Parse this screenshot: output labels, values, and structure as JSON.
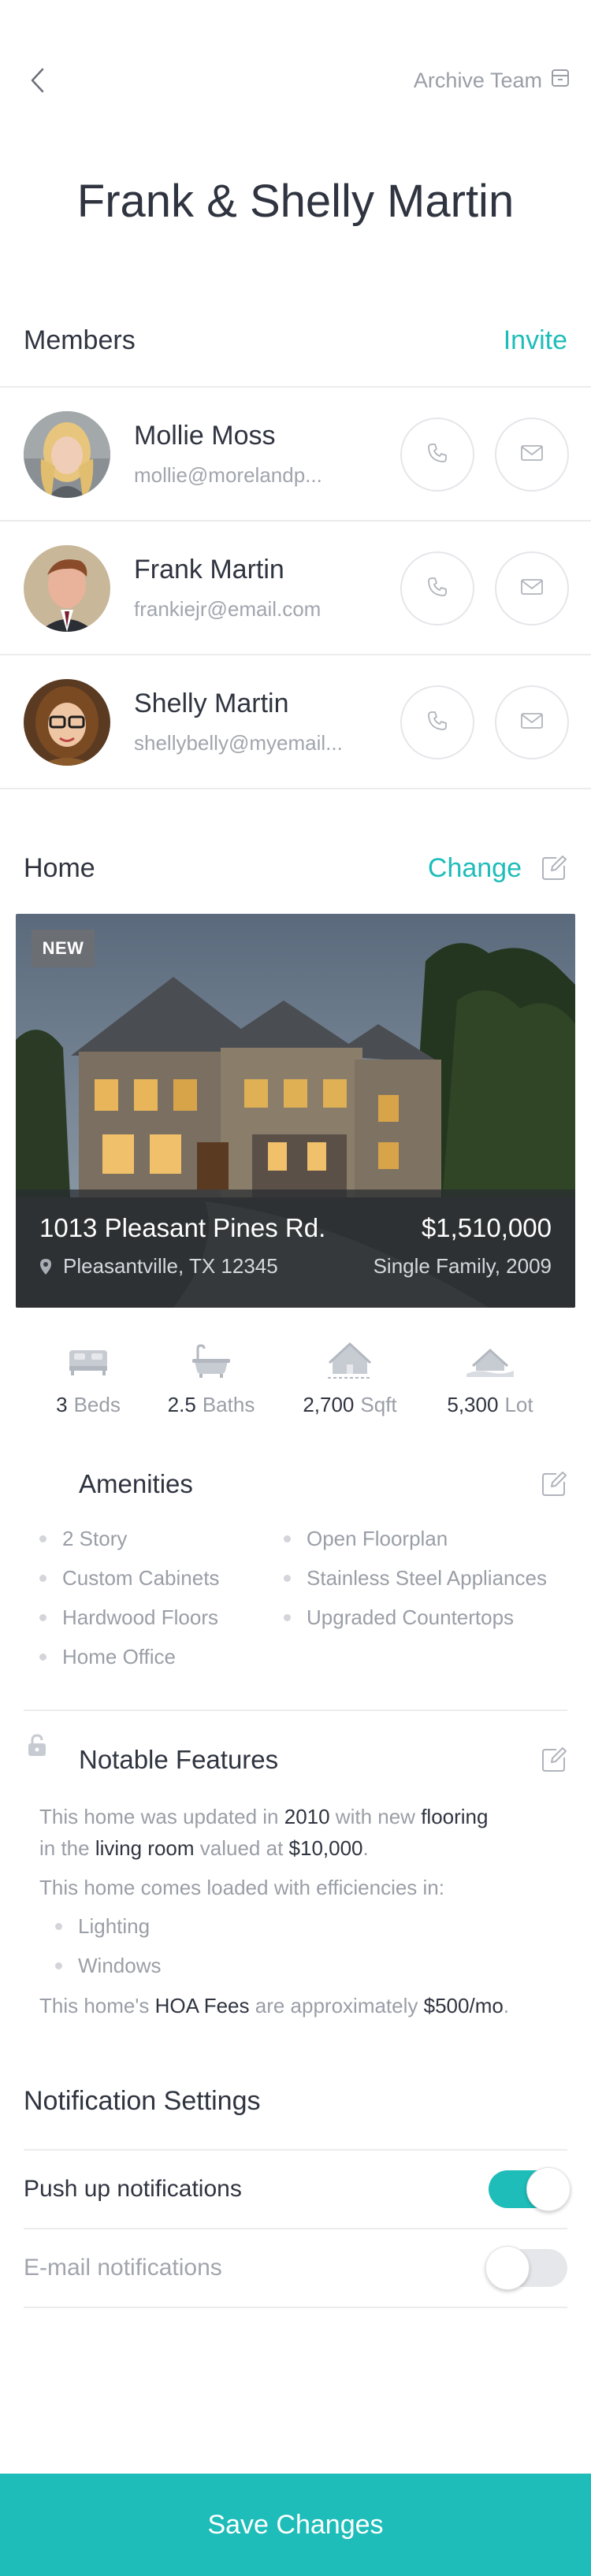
{
  "header": {
    "archive_label": "Archive Team",
    "title": "Frank & Shelly Martin"
  },
  "members": {
    "label": "Members",
    "invite_label": "Invite",
    "list": [
      {
        "name": "Mollie Moss",
        "email": "mollie@morelandp..."
      },
      {
        "name": "Frank Martin",
        "email": "frankiejr@email.com"
      },
      {
        "name": "Shelly Martin",
        "email": "shellybelly@myemail..."
      }
    ]
  },
  "home": {
    "label": "Home",
    "change_label": "Change",
    "badge": "NEW",
    "address": "1013 Pleasant Pines Rd.",
    "price": "$1,510,000",
    "city": "Pleasantville, TX 12345",
    "property_type": "Single Family, 2009",
    "stats": [
      {
        "value": "3",
        "unit": "Beds",
        "icon": "bed-icon"
      },
      {
        "value": "2.5",
        "unit": "Baths",
        "icon": "bathtub-icon"
      },
      {
        "value": "2,700",
        "unit": "Sqft",
        "icon": "house-sqft-icon"
      },
      {
        "value": "5,300",
        "unit": "Lot",
        "icon": "lot-icon"
      }
    ]
  },
  "amenities": {
    "title": "Amenities",
    "left": [
      "2 Story",
      "Custom Cabinets",
      "Hardwood Floors",
      "Home Office"
    ],
    "right": [
      "Open Floorplan",
      "Stainless Steel Appliances",
      "Upgraded Countertops"
    ]
  },
  "features": {
    "title": "Notable Features",
    "p1": {
      "a": "This home was updated in ",
      "b": "2010",
      "c": " with new ",
      "d": "flooring",
      "e": "in the ",
      "f": "living room",
      "g": " valued at ",
      "h": "$10,000",
      "i": "."
    },
    "p2": "This home comes loaded with efficiencies in:",
    "efficiencies": [
      "Lighting",
      "Windows"
    ],
    "p3": {
      "a": "This home's ",
      "b": "HOA Fees",
      "c": " are approximately ",
      "d": "$500/mo",
      "e": "."
    }
  },
  "notifications": {
    "title": "Notification Settings",
    "push_label": "Push up notifications",
    "push_on": true,
    "email_label": "E-mail notifications",
    "email_on": false
  },
  "save_label": "Save Changes",
  "colors": {
    "accent": "#1ebdb9",
    "text": "#2f3440",
    "muted": "#9a9ea6"
  }
}
